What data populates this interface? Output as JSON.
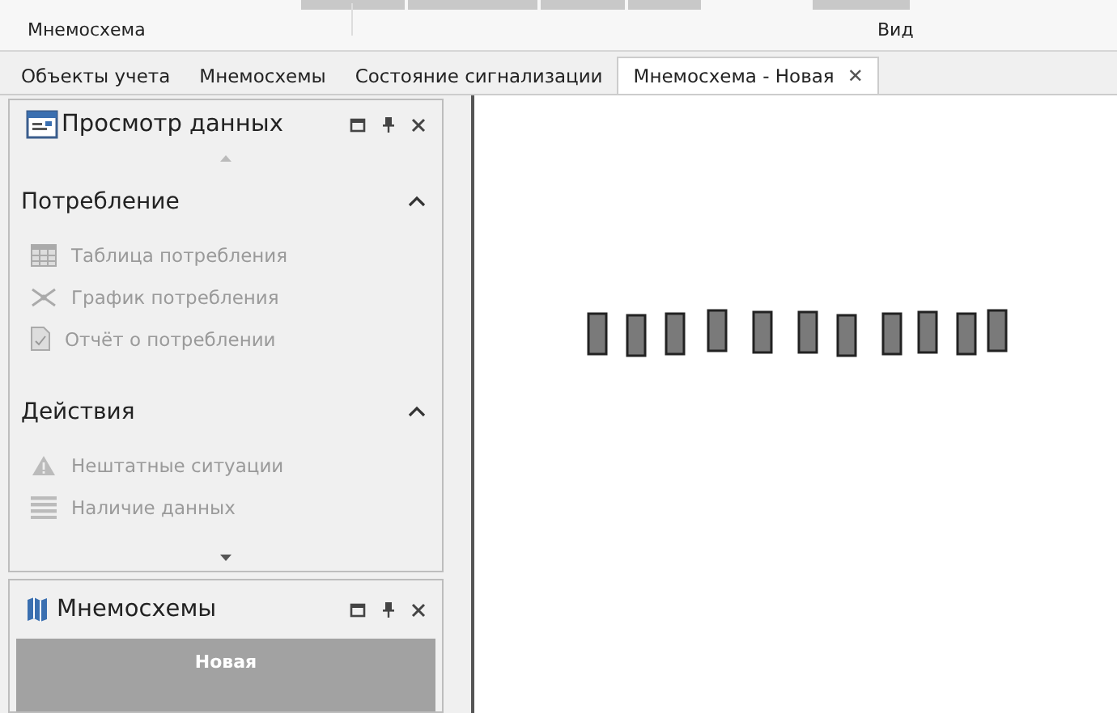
{
  "ribbon": {
    "groups": [
      {
        "label": "Мнемосхема"
      },
      {
        "label": "Вид"
      }
    ]
  },
  "tabs": [
    {
      "label": "Объекты учета",
      "selected": false
    },
    {
      "label": "Мнемосхемы",
      "selected": false
    },
    {
      "label": "Состояние сигнализации",
      "selected": false
    },
    {
      "label": "Мнемосхема - Новая",
      "selected": true,
      "close": "✕"
    }
  ],
  "data_panel": {
    "title": "Просмотр данных",
    "sections": [
      {
        "title": "Потребление",
        "expanded": true,
        "items": [
          {
            "label": "Таблица потребления",
            "kind": "table"
          },
          {
            "label": "График потребления",
            "kind": "graph"
          },
          {
            "label": "Отчёт о потреблении",
            "kind": "report"
          }
        ]
      },
      {
        "title": "Действия",
        "expanded": true,
        "items": [
          {
            "label": "Нештатные ситуации",
            "kind": "warning"
          },
          {
            "label": "Наличие данных",
            "kind": "list"
          }
        ]
      }
    ]
  },
  "schemes_panel": {
    "title": "Мнемосхемы",
    "items": [
      {
        "label": "Новая",
        "selected": true
      }
    ]
  }
}
